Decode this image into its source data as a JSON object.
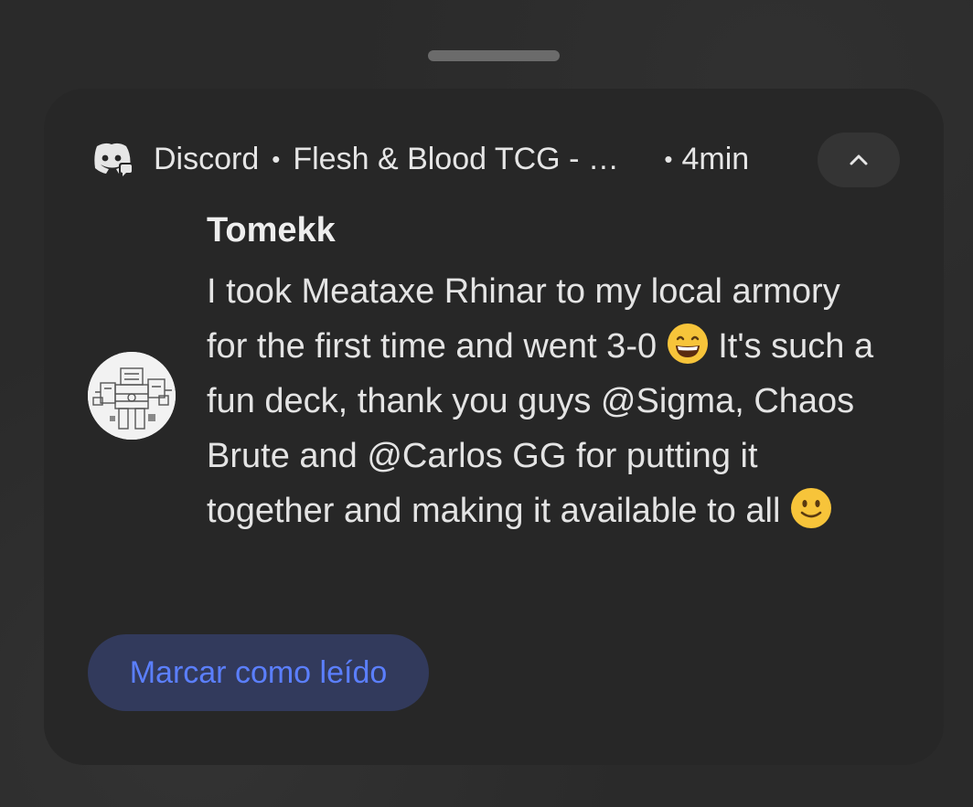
{
  "notification": {
    "app_name": "Discord",
    "app_icon": "discord-icon",
    "separator": "•",
    "channel": "Flesh & Blood TCG - Community",
    "time": "4min",
    "collapse_icon": "chevron-up-icon",
    "sender": "Tomekk",
    "message": {
      "part1": "I took Meataxe Rhinar to my local armory for the first time and went 3-0 ",
      "emoji1": "grinning-face-emoji",
      "part2": " It's such a fun deck, thank you guys @Sigma, Chaos Brute and @Carlos GG for putting it together and making it available to all ",
      "emoji2": "slightly-smiling-face-emoji"
    },
    "action_label": "Marcar como leído",
    "avatar": "robot-mech-avatar"
  },
  "colors": {
    "card_bg": "#272727",
    "action_bg": "#323a5c",
    "action_text": "#5b7fff",
    "text": "#e4e4e4"
  }
}
